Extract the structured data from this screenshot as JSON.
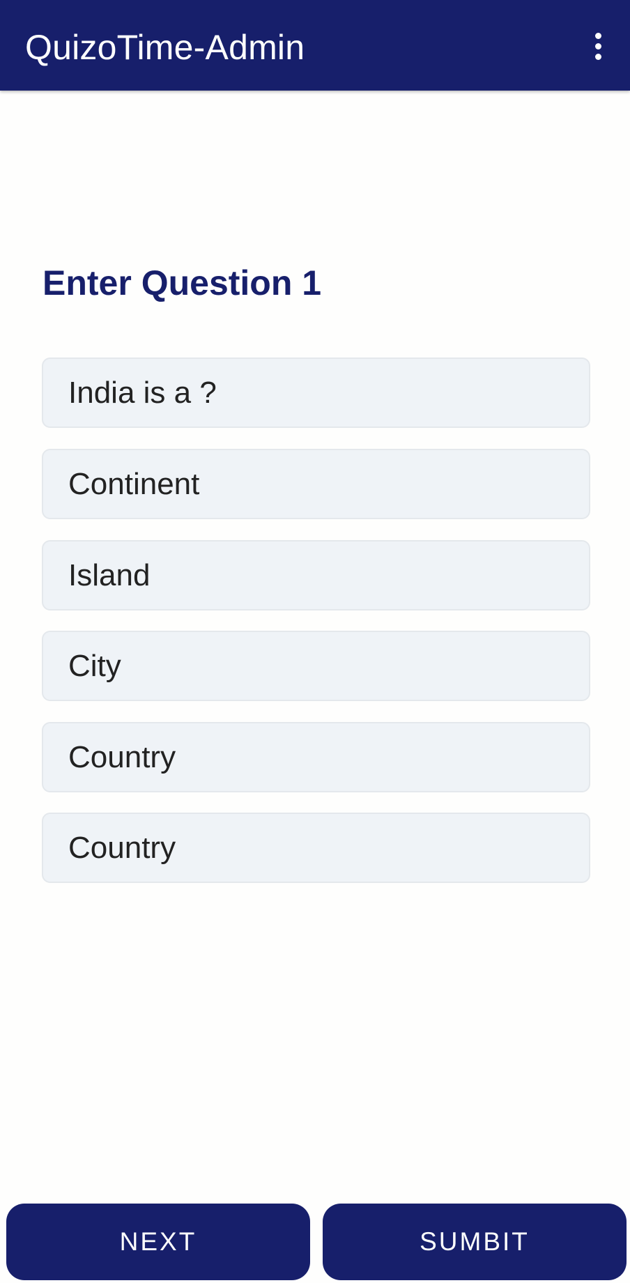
{
  "app_bar": {
    "title": "QuizoTime-Admin",
    "overflow_icon": "more-vert-icon",
    "background": "#171f6b"
  },
  "form": {
    "heading": "Enter Question 1",
    "question": "India is a ?",
    "options": [
      "Continent",
      "Island",
      "City",
      "Country"
    ],
    "answer": "Country"
  },
  "buttons": {
    "next_label": "NEXT",
    "submit_label": "SUMBIT"
  },
  "colors": {
    "accent": "#171f6b",
    "field_background": "#eff3f7"
  }
}
